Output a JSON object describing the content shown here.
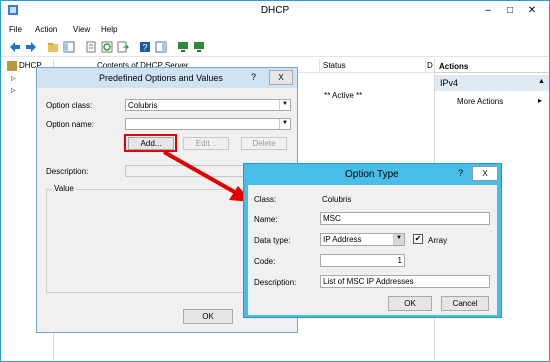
{
  "window": {
    "title": "DHCP",
    "icon": "dhcp-icon",
    "accent": "#2b9bd8"
  },
  "menu": [
    "File",
    "Action",
    "View",
    "Help"
  ],
  "toolbar_icons": [
    "back-arrow-icon",
    "forward-arrow-icon",
    "folder-icon",
    "console-tree-icon",
    "properties-icon",
    "refresh-icon",
    "export-icon",
    "help-icon",
    "show-pane-icon",
    "monitor-icon",
    "monitor2-icon"
  ],
  "tree": {
    "root": "DHCP"
  },
  "list": {
    "columns": [
      "Contents of DHCP Server",
      "Status",
      "D"
    ],
    "status_value": "** Active **"
  },
  "actions": {
    "header": "Actions",
    "section": "IPv4",
    "more": "More Actions"
  },
  "predefined_dialog": {
    "title": "Predefined Options and Values",
    "help": "?",
    "close": "X",
    "option_class_label": "Option class:",
    "option_class_value": "Colubris",
    "option_name_label": "Option name:",
    "option_name_value": "",
    "add": "Add...",
    "edit": "Edit...",
    "delete": "Delete",
    "description_label": "Description:",
    "value_group": "Value",
    "ok": "OK"
  },
  "option_type_dialog": {
    "title": "Option Type",
    "help": "?",
    "close": "X",
    "class_label": "Class:",
    "class_value": "Colubris",
    "name_label": "Name:",
    "name_value": "MSC",
    "data_type_label": "Data type:",
    "data_type_value": "IP Address",
    "array_label": "Array",
    "array_checked": true,
    "code_label": "Code:",
    "code_value": "1",
    "description_label": "Description:",
    "description_value": "List of MSC IP Addresses",
    "ok": "OK",
    "cancel": "Cancel"
  },
  "annotation_color": "#e00000"
}
